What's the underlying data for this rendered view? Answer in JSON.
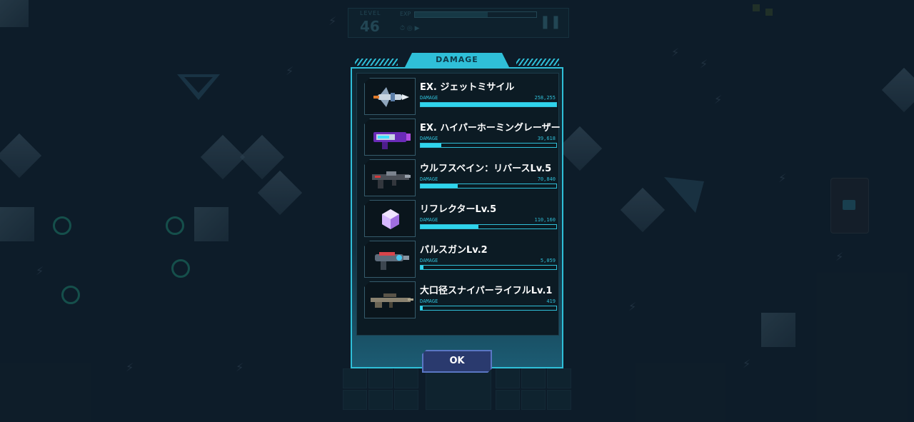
{
  "hud": {
    "level_label": "LEVEL",
    "level_value": "46",
    "exp_label": "EXP"
  },
  "dialog": {
    "title": "DAMAGE",
    "ok_label": "OK",
    "damage_label": "DAMAGE",
    "rows": [
      {
        "name": "EX. ジェットミサイル",
        "damage": "258,255",
        "fraction": 1.0,
        "icon": "jet-missile-icon"
      },
      {
        "name": "EX. ハイパーホーミングレーザー",
        "damage": "39,618",
        "fraction": 0.153,
        "icon": "homing-laser-gun-icon"
      },
      {
        "name": "ウルフスベイン：リバースLv.5",
        "damage": "70,840",
        "fraction": 0.274,
        "icon": "wolfsbane-rifle-icon"
      },
      {
        "name": "リフレクターLv.5",
        "damage": "110,160",
        "fraction": 0.427,
        "icon": "reflector-cube-icon"
      },
      {
        "name": "パルスガンLv.2",
        "damage": "5,059",
        "fraction": 0.02,
        "icon": "pulse-gun-icon"
      },
      {
        "name": "大口径スナイパーライフルLv.1",
        "damage": "419",
        "fraction": 0.002,
        "icon": "sniper-rifle-icon"
      }
    ]
  },
  "colors": {
    "accent": "#2fbfd8",
    "bar_fill": "#2fd4ec",
    "button": "#2a3a6e"
  }
}
